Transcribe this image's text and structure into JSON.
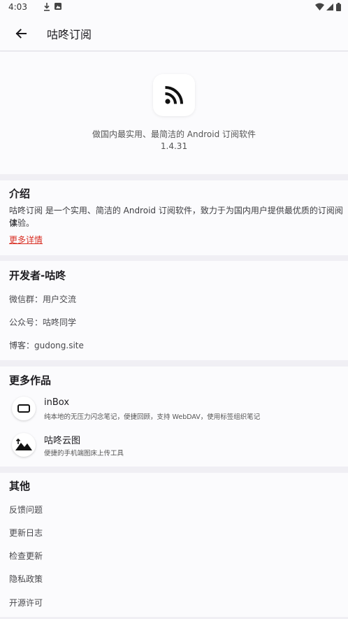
{
  "status_bar": {
    "time": "4:03"
  },
  "app_bar": {
    "title": "咕咚订阅"
  },
  "hero": {
    "description": "做国内最实用、最简洁的 Android 订阅软件",
    "version": "1.4.31"
  },
  "intro": {
    "title": "介绍",
    "body_line1": "咕咚订阅 是一个实用、简洁的 Android 订阅软件，致力于为国内用户提供最优质的订阅阅读",
    "body_line2": "体验。",
    "more_link": "更多详情"
  },
  "developer": {
    "title": "开发者-咕咚",
    "items": [
      "微信群：用户交流",
      "公众号：咕咚同学",
      "博客：gudong.site"
    ]
  },
  "works": {
    "title": "更多作品",
    "items": [
      {
        "name": "inBox",
        "desc": "纯本地的无压力闪念笔记，便捷回顾，支持 WebDAV，使用标签组织笔记"
      },
      {
        "name": "咕咚云图",
        "desc": "便捷的手机端图床上传工具"
      }
    ]
  },
  "other": {
    "title": "其他",
    "items": [
      "反馈问题",
      "更新日志",
      "检查更新",
      "隐私政策",
      "开源许可"
    ]
  },
  "colors": {
    "link": "#d93025",
    "background": "#f0eff4",
    "card": "#fbfbfd"
  }
}
